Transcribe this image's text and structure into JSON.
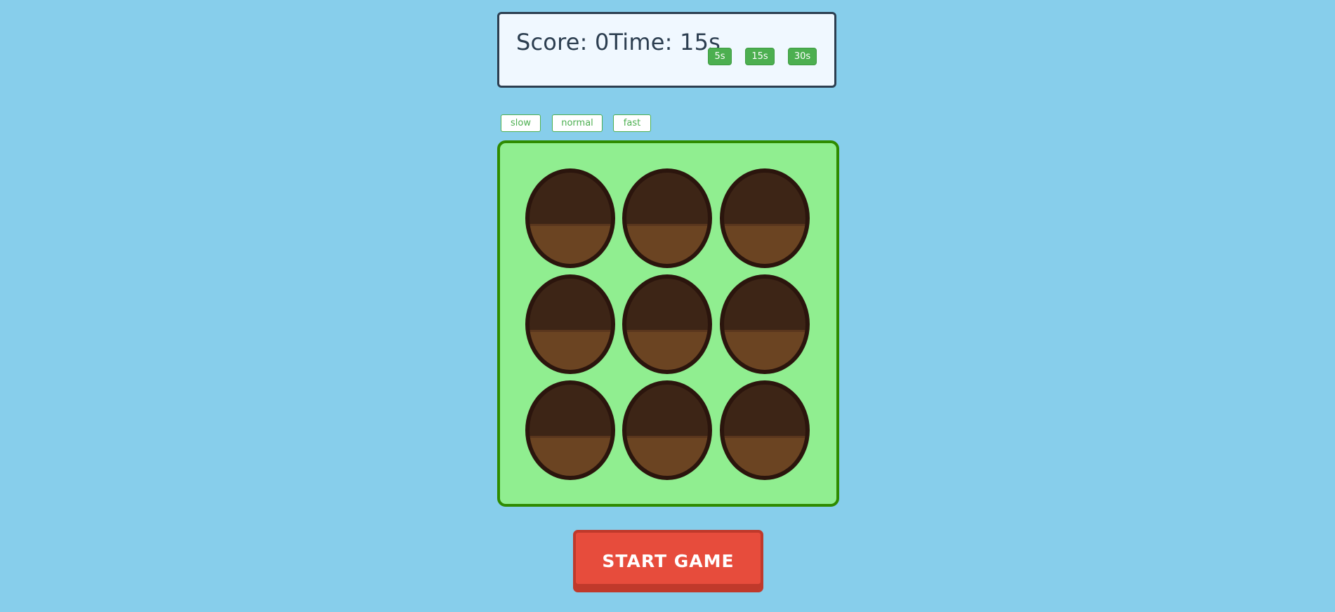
{
  "scoreboard": {
    "score_text": "Score: 0",
    "time_text": "Time: 15s",
    "duration_buttons": [
      "5s",
      "15s",
      "30s"
    ]
  },
  "speed_buttons": [
    "slow",
    "normal",
    "fast"
  ],
  "board": {
    "rows": 3,
    "cols": 3,
    "hole_icon": "dirt-hole-icon"
  },
  "start_button_label": "START GAME",
  "colors": {
    "background": "#87ceeb",
    "board": "#90ee90",
    "board_border": "#2e8b00",
    "accent_green": "#4caf50",
    "start_button": "#e74c3c",
    "hole_dark": "#3d2516",
    "hole_light": "#6b4422"
  }
}
